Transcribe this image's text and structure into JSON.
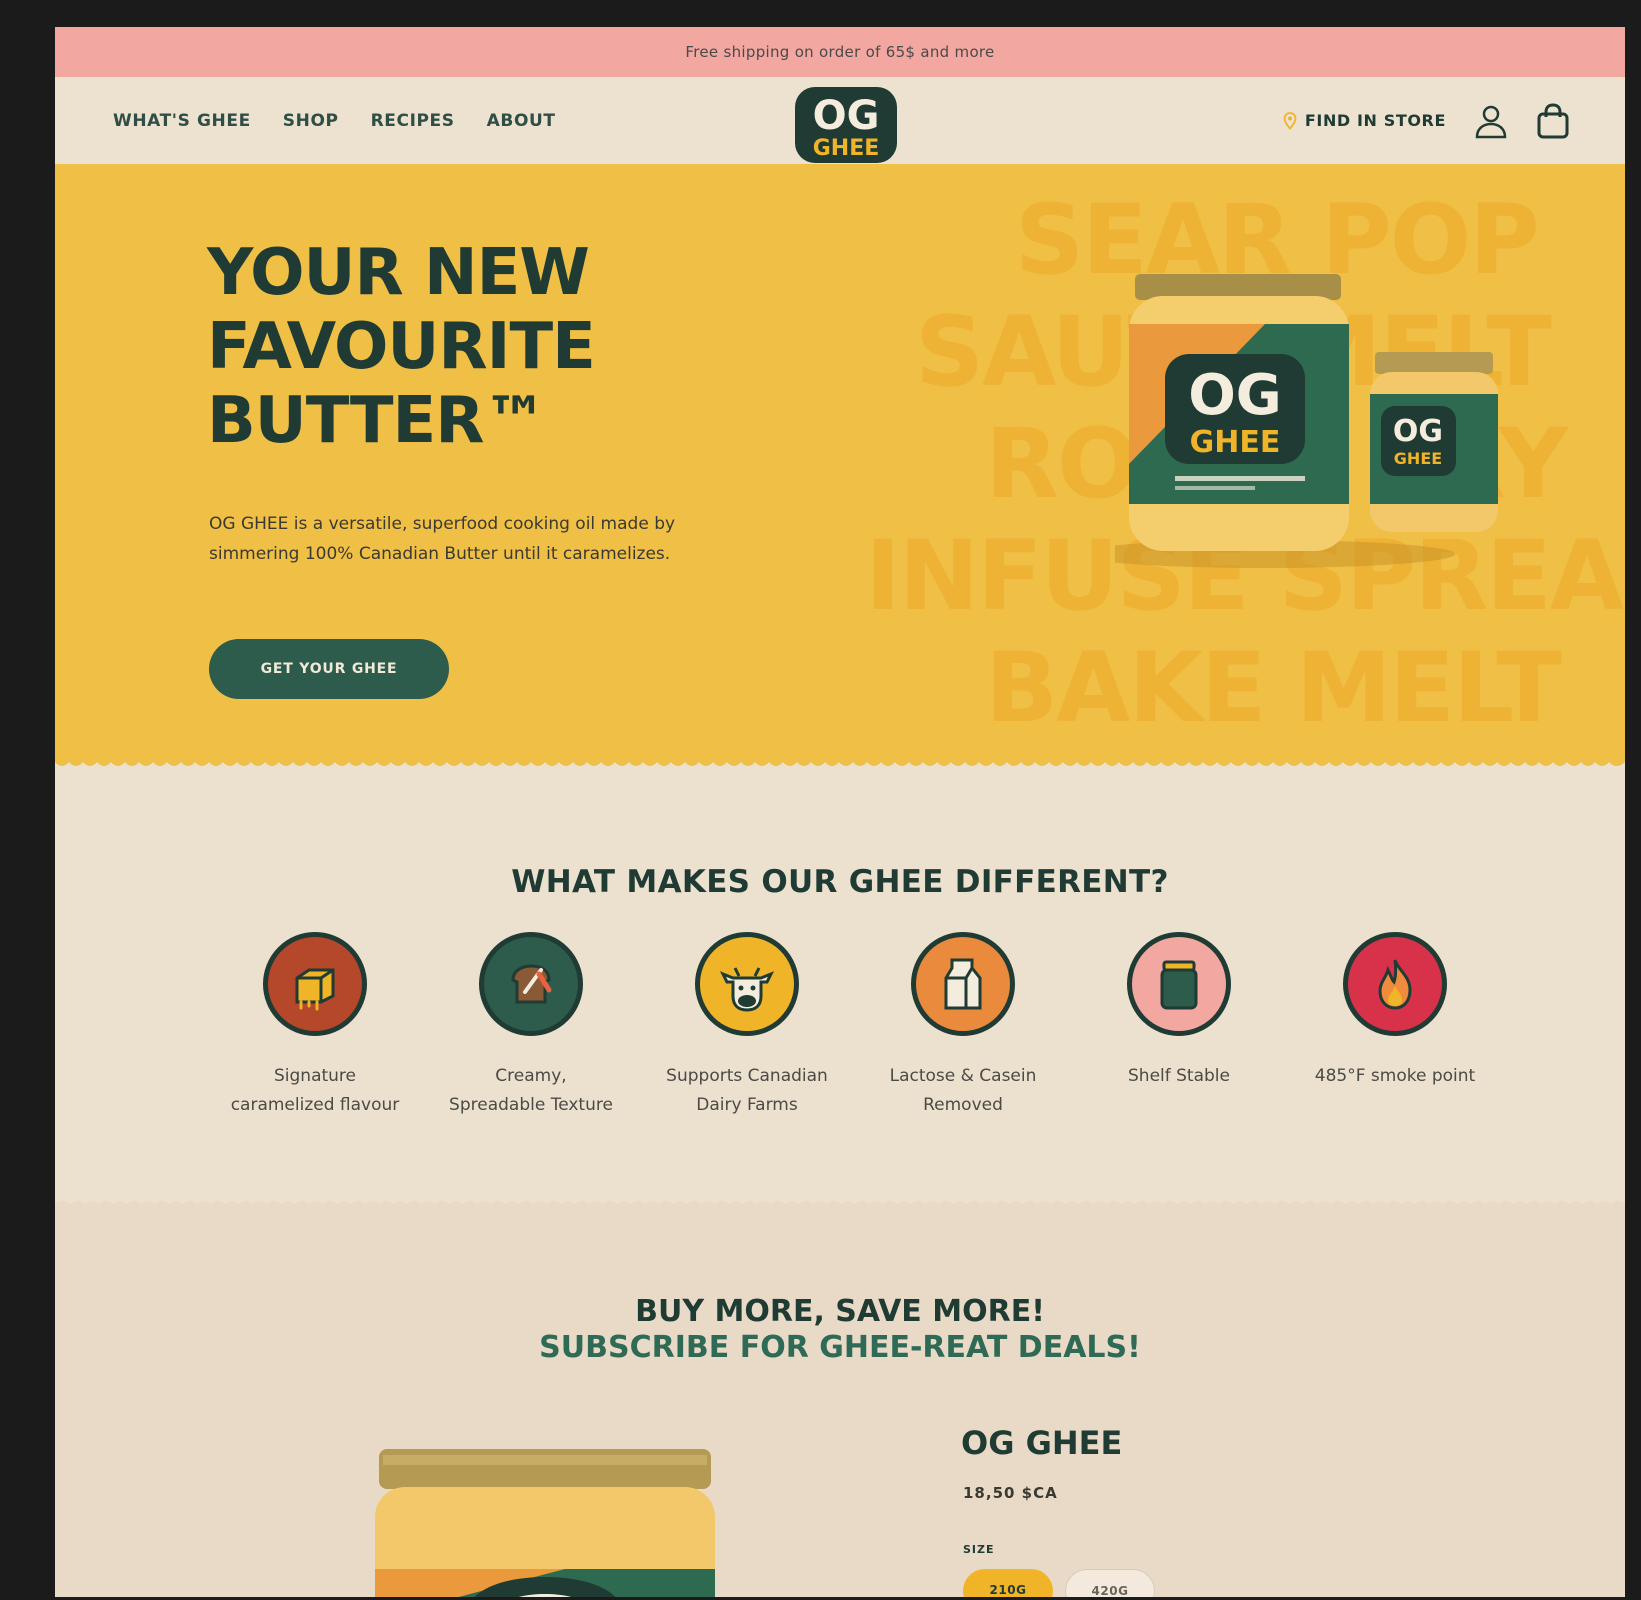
{
  "announcement": "Free shipping on order of 65$ and more",
  "nav": {
    "items": [
      "WHAT'S GHEE",
      "SHOP",
      "RECIPES",
      "ABOUT"
    ],
    "find_in_store": "FIND IN STORE"
  },
  "logo": {
    "line1": "OG",
    "line2": "GHEE"
  },
  "hero": {
    "title_line1": "YOUR NEW",
    "title_line2": "FAVOURITE",
    "title_line3": "BUTTER™",
    "description_line1": "OG GHEE is a versatile, superfood cooking oil made by",
    "description_line2": "simmering 100% Canadian Butter until it caramelizes.",
    "cta": "GET YOUR GHEE",
    "background_words": [
      "SEAR POP",
      "SAUTÉ MELT",
      "ROAST FRY",
      "INFUSE SPREAD",
      "BAKE MELT"
    ]
  },
  "features": {
    "title": "WHAT MAKES OUR GHEE DIFFERENT?",
    "items": [
      {
        "line1": "Signature",
        "line2": "caramelized flavour",
        "icon": "butter-icon",
        "color": "#b5472a"
      },
      {
        "line1": "Creamy,",
        "line2": "Spreadable Texture",
        "icon": "toast-knife-icon",
        "color": "#2d5b4c"
      },
      {
        "line1": "Supports Canadian",
        "line2": "Dairy Farms",
        "icon": "cow-icon",
        "color": "#f0b428"
      },
      {
        "line1": "Lactose & Casein",
        "line2": "Removed",
        "icon": "milk-carton-icon",
        "color": "#ea8a3c"
      },
      {
        "line1": "Shelf Stable",
        "line2": "",
        "icon": "jar-icon",
        "color": "#f2a7a1"
      },
      {
        "line1": "485°F smoke point",
        "line2": "",
        "icon": "flame-icon",
        "color": "#d8324a"
      }
    ]
  },
  "subscribe": {
    "title_line1": "BUY MORE, SAVE MORE!",
    "title_line2": "SUBSCRIBE FOR GHEE-REAT DEALS!"
  },
  "product": {
    "name": "OG GHEE",
    "price": "18,50 $CA",
    "size_label": "SIZE",
    "sizes": [
      "210G",
      "420G"
    ],
    "selected_size": "210G"
  },
  "colors": {
    "green": "#1f3b34",
    "mustard": "#f0bf45",
    "pink": "#f2a7a1",
    "cream": "#ece0cf"
  }
}
